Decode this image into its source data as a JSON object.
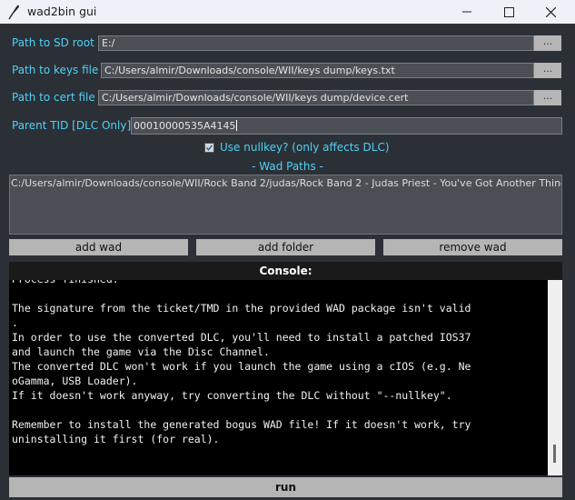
{
  "window": {
    "title": "wad2bin gui",
    "icon": "feather-icon"
  },
  "fields": {
    "sd_root": {
      "label": "Path to SD root -",
      "value": "E:/",
      "browse_label": "..."
    },
    "keys_file": {
      "label": "Path to keys file -",
      "value": "C:/Users/almir/Downloads/console/WII/keys dump/keys.txt",
      "browse_label": "..."
    },
    "cert_file": {
      "label": "Path to cert file -",
      "value": "C:/Users/almir/Downloads/console/WII/keys dump/device.cert",
      "browse_label": "..."
    },
    "parent_tid": {
      "label": "Parent TID [DLC Only] -",
      "value": "00010000535A4145"
    }
  },
  "nullkey": {
    "label": "Use nullkey? (only affects DLC)",
    "checked": true
  },
  "wad_paths": {
    "label": "- Wad Paths -",
    "items": [
      "C:/Users/almir/Downloads/console/WII/Rock Band 2/judas/Rock Band 2 - Judas Priest - You've Got Another Thing C"
    ]
  },
  "buttons": {
    "add_wad": "add wad",
    "add_folder": "add folder",
    "remove_wad": "remove wad",
    "run": "run"
  },
  "console": {
    "title": "Console:",
    "lines": [
      "Process finished.",
      "",
      "The signature from the ticket/TMD in the provided WAD package isn't valid",
      ".",
      "In order to use the converted DLC, you'll need to install a patched IOS37",
      "and launch the game via the Disc Channel.",
      "The converted DLC won't work if you launch the game using a cIOS (e.g. Ne",
      "oGamma, USB Loader).",
      "If it doesn't work anyway, try converting the DLC without \"--nullkey\".",
      "",
      "Remember to install the generated bogus WAD file! If it doesn't work, try",
      "uninstalling it first (for real)."
    ]
  },
  "colors": {
    "background": "#2b3036",
    "label": "#4fd0f5",
    "field_bg": "#4b4f55",
    "button_bg": "#b5b5b5",
    "console_bg": "#000000"
  }
}
